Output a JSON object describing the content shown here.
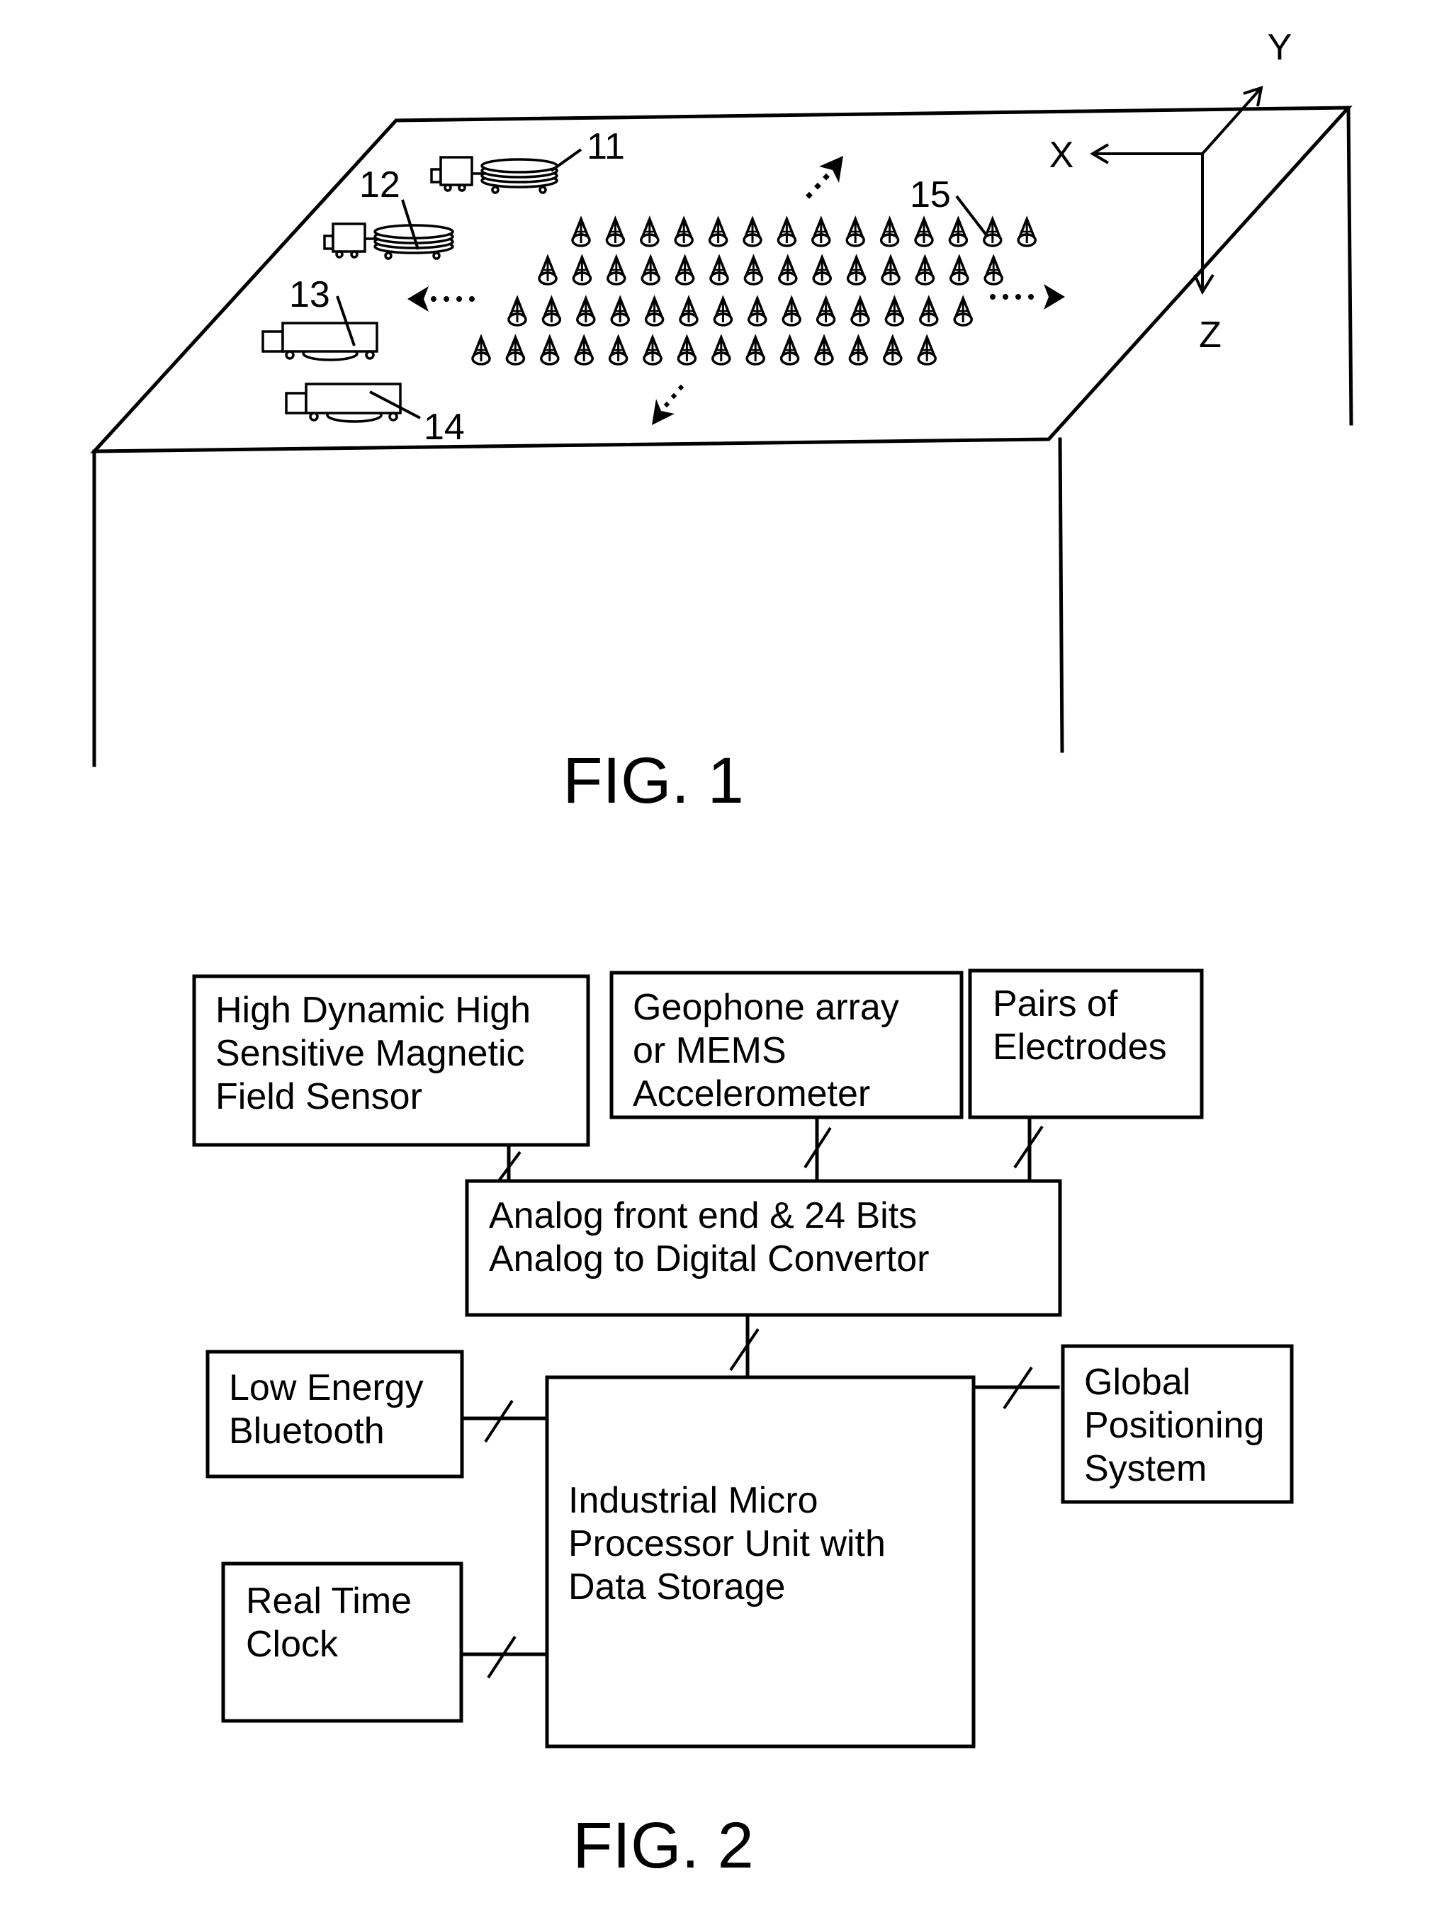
{
  "document": {
    "type": "patent drawing sheet",
    "figures": [
      "FIG. 1",
      "FIG. 2"
    ]
  },
  "fig1": {
    "caption": "FIG. 1",
    "axes": {
      "x": "X",
      "y": "Y",
      "z": "Z"
    },
    "reference_numerals": {
      "device_11": "11",
      "device_12": "12",
      "device_13": "13",
      "device_14": "14",
      "sensor_array_15": "15"
    },
    "sensor_array": {
      "rows": 4,
      "cones_per_row": [
        14,
        14,
        14,
        14
      ]
    },
    "direction_arrows": [
      "up-right",
      "left",
      "right",
      "down-left"
    ]
  },
  "fig2": {
    "caption": "FIG. 2",
    "blocks": {
      "magnetic": [
        "High Dynamic High",
        "Sensitive Magnetic",
        "Field Sensor"
      ],
      "geophone": [
        "Geophone array",
        "or MEMS",
        "Accelerometer"
      ],
      "electrodes": [
        "Pairs of",
        "Electrodes"
      ],
      "adc": [
        "Analog front end & 24 Bits",
        "Analog to Digital Convertor"
      ],
      "bluetooth": [
        "Low Energy",
        "Bluetooth"
      ],
      "mpu": [
        "Industrial Micro",
        "Processor Unit with",
        "Data Storage"
      ],
      "gps": [
        "Global",
        "Positioning",
        "System"
      ],
      "rtc": [
        "Real Time",
        "Clock"
      ]
    },
    "connections": [
      {
        "from": "magnetic",
        "to": "adc",
        "bus": true
      },
      {
        "from": "geophone",
        "to": "adc",
        "bus": true
      },
      {
        "from": "electrodes",
        "to": "adc",
        "bus": true
      },
      {
        "from": "adc",
        "to": "mpu",
        "bus": true
      },
      {
        "from": "bluetooth",
        "to": "mpu",
        "bus": true
      },
      {
        "from": "rtc",
        "to": "mpu",
        "bus": true
      },
      {
        "from": "gps",
        "to": "mpu",
        "bus": true
      }
    ]
  }
}
